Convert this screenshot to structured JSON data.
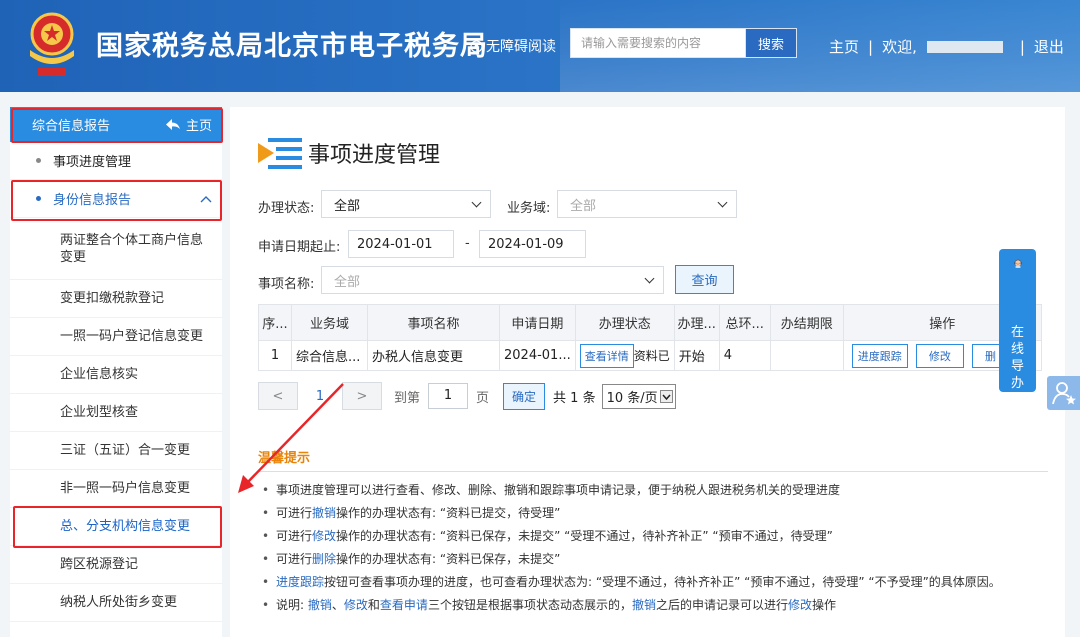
{
  "header": {
    "site_title": "国家税务总局北京市电子税务局",
    "accessibility_label": "无障碍阅读",
    "search_placeholder": "请输入需要搜索的内容",
    "search_button": "搜索",
    "nav_home": "主页",
    "nav_sep1": "|",
    "nav_welcome": "欢迎,",
    "nav_sep2": "|",
    "nav_logout": "退出"
  },
  "sidebar": {
    "header_label": "综合信息报告",
    "home_label": "主页",
    "items": [
      {
        "label": "事项进度管理",
        "level": 1
      },
      {
        "label": "身份信息报告",
        "level": 1,
        "expanded": true
      },
      {
        "label": "两证整合个体工商户信息变更",
        "level": 2
      },
      {
        "label": "变更扣缴税款登记",
        "level": 2
      },
      {
        "label": "一照一码户登记信息变更",
        "level": 2
      },
      {
        "label": "企业信息核实",
        "level": 2
      },
      {
        "label": "企业划型核查",
        "level": 2
      },
      {
        "label": "三证（五证）合一变更",
        "level": 2
      },
      {
        "label": "非一照一码户信息变更",
        "level": 2
      },
      {
        "label": "总、分支机构信息变更",
        "level": 2,
        "selected": true
      },
      {
        "label": "跨区税源登记",
        "level": 2
      },
      {
        "label": "纳税人所处街乡变更",
        "level": 2
      }
    ]
  },
  "main": {
    "page_title": "事项进度管理",
    "filters": {
      "status_label": "办理状态:",
      "status_value": "全部",
      "domain_label": "业务域:",
      "domain_value": "全部",
      "date_label": "申请日期起止:",
      "date_from": "2024-01-01",
      "date_sep": "-",
      "date_to": "2024-01-09",
      "name_label": "事项名称:",
      "name_value": "全部",
      "query_button": "查询"
    },
    "table": {
      "headers": [
        "序...",
        "业务域",
        "事项名称",
        "申请日期",
        "办理状态",
        "办理...",
        "总环...",
        "办结期限",
        "操作"
      ],
      "rows": [
        {
          "seq": "1",
          "domain": "综合信息...",
          "name": "办税人信息变更",
          "date": "2024-01...",
          "status_btn": "查看详情",
          "status_text": "资料已",
          "handle": "开始",
          "steps": "4",
          "deadline": "",
          "op_track": "进度跟踪",
          "op_edit": "修改",
          "op_delete": "删"
        }
      ]
    },
    "pager": {
      "prev": "<",
      "page": "1",
      "next": ">",
      "goto_label": "到第",
      "goto_value": "1",
      "page_unit": "页",
      "confirm": "确定",
      "total": "共 1 条",
      "page_size": "10 条/页"
    },
    "tips": {
      "title": "温馨提示",
      "lines": [
        {
          "parts": [
            {
              "t": "事项进度管理可以进行查看、修改、删除、撤销和跟踪事项申请记录，便于纳税人跟进税务机关的受理进度"
            }
          ]
        },
        {
          "parts": [
            {
              "t": "可进行"
            },
            {
              "t": "撤销",
              "link": true
            },
            {
              "t": "操作的办理状态有: “资料已提交，待受理”"
            }
          ]
        },
        {
          "parts": [
            {
              "t": "可进行"
            },
            {
              "t": "修改",
              "link": true
            },
            {
              "t": "操作的办理状态有: “资料已保存，未提交” “受理不通过，待补齐补正” “预审不通过，待受理”"
            }
          ]
        },
        {
          "parts": [
            {
              "t": "可进行"
            },
            {
              "t": "删除",
              "link": true
            },
            {
              "t": "操作的办理状态有: “资料已保存，未提交”"
            }
          ]
        },
        {
          "parts": [
            {
              "t": "进度跟踪",
              "link": true
            },
            {
              "t": "按钮可查看事项办理的进度，也可查看办理状态为: “受理不通过，待补齐补正” “预审不通过，待受理” “不予受理”的具体原因。"
            }
          ]
        },
        {
          "parts": [
            {
              "t": "说明: "
            },
            {
              "t": "撤销",
              "link": true
            },
            {
              "t": "、"
            },
            {
              "t": "修改",
              "link": true
            },
            {
              "t": "和"
            },
            {
              "t": "查看申请",
              "link": true
            },
            {
              "t": "三个按钮是根据事项状态动态展示的，"
            },
            {
              "t": "撤销",
              "link": true
            },
            {
              "t": "之后的申请记录可以进行"
            },
            {
              "t": "修改",
              "link": true
            },
            {
              "t": "操作"
            }
          ]
        }
      ]
    }
  },
  "float": {
    "guide_label": "在线导办"
  },
  "colors": {
    "header_blue": "#2a6bc1",
    "accent_blue": "#2a8ce0",
    "highlight_red": "#e8262a",
    "tips_orange": "#e8840a"
  }
}
